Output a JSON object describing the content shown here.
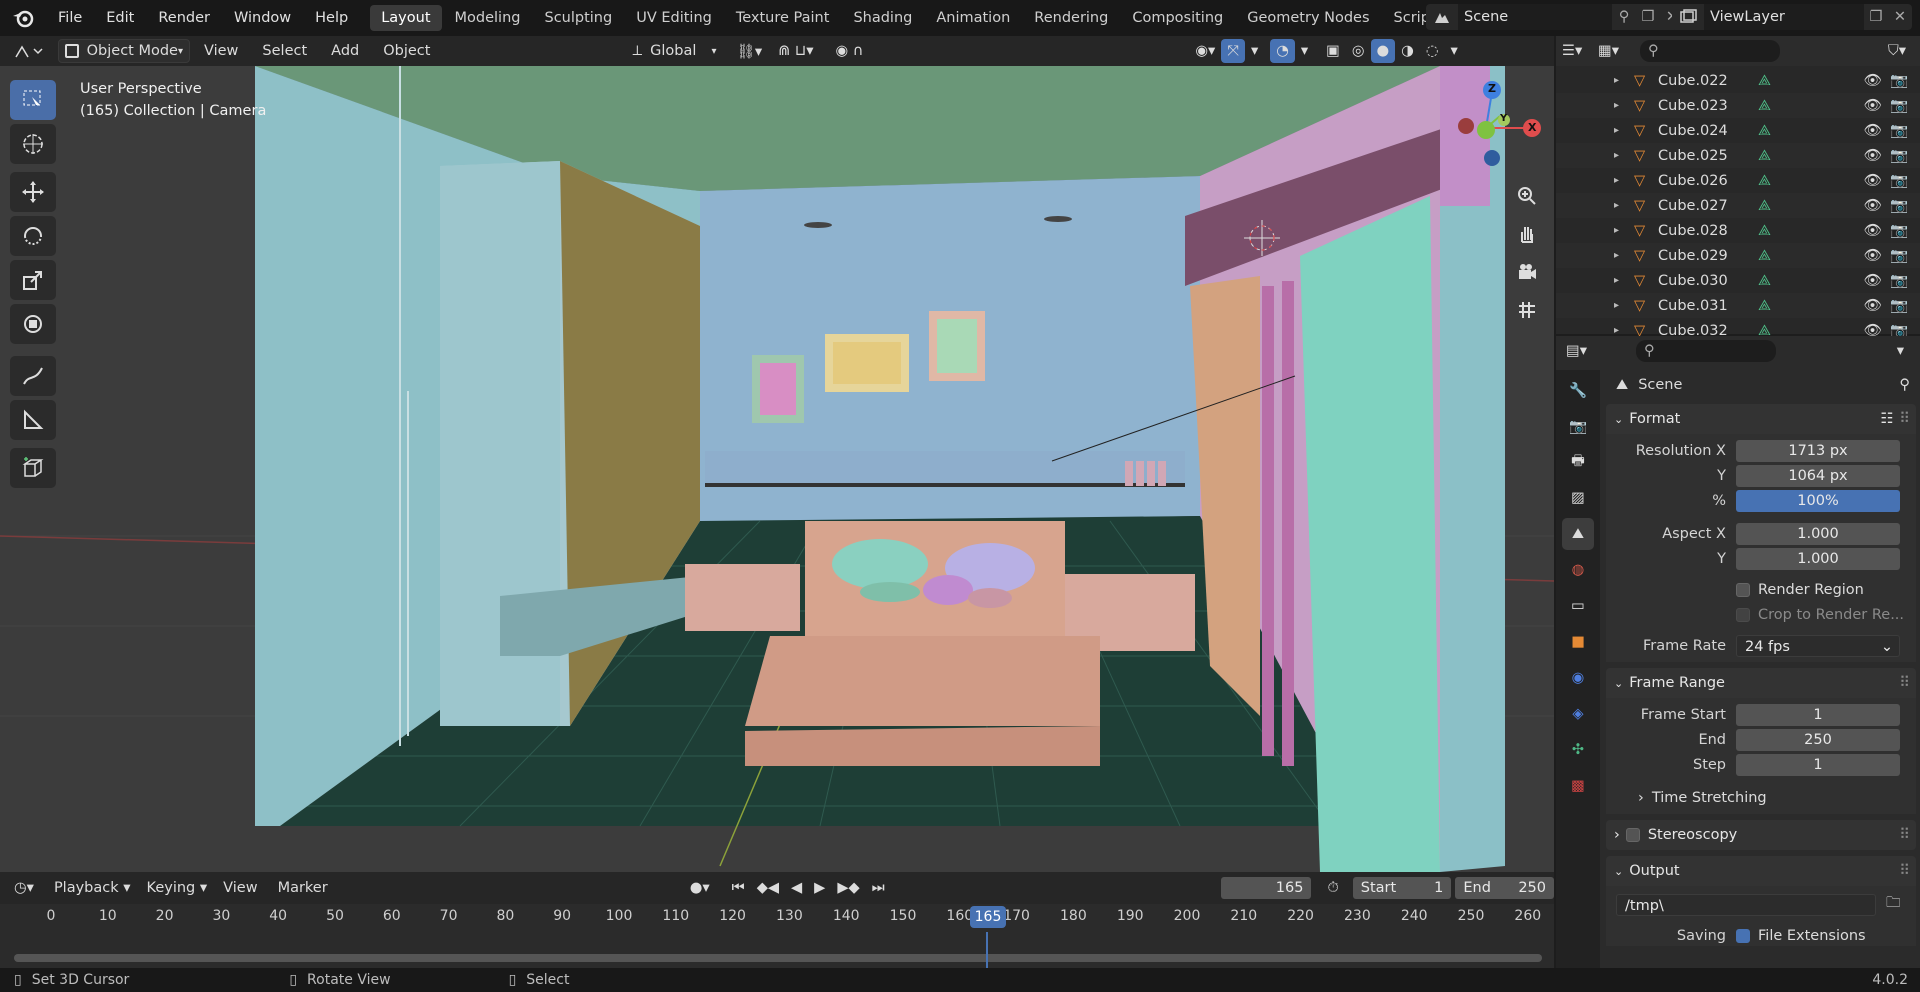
{
  "menus": [
    "File",
    "Edit",
    "Render",
    "Window",
    "Help"
  ],
  "workspaces": [
    {
      "label": "Layout",
      "active": true
    },
    {
      "label": "Modeling"
    },
    {
      "label": "Sculpting"
    },
    {
      "label": "UV Editing"
    },
    {
      "label": "Texture Paint"
    },
    {
      "label": "Shading"
    },
    {
      "label": "Animation"
    },
    {
      "label": "Rendering"
    },
    {
      "label": "Compositing"
    },
    {
      "label": "Geometry Nodes"
    },
    {
      "label": "Scripting"
    }
  ],
  "scene": {
    "name": "Scene"
  },
  "view_layer": {
    "name": "ViewLayer"
  },
  "viewport_header": {
    "mode": "Object Mode",
    "menus": [
      "View",
      "Select",
      "Add",
      "Object"
    ],
    "orientation": "Global"
  },
  "viewport": {
    "perspective": "User Perspective",
    "collection_line": "(165) Collection | Camera",
    "axes": {
      "z": "Z",
      "y": "Y",
      "x": "X"
    }
  },
  "outliner": {
    "items": [
      "Cube.022",
      "Cube.023",
      "Cube.024",
      "Cube.025",
      "Cube.026",
      "Cube.027",
      "Cube.028",
      "Cube.029",
      "Cube.030",
      "Cube.031",
      "Cube.032"
    ]
  },
  "properties": {
    "context": "Scene",
    "format": {
      "title": "Format",
      "res_x_label": "Resolution X",
      "res_x": "1713 px",
      "res_y_label": "Y",
      "res_y": "1064 px",
      "pct_label": "%",
      "pct": "100%",
      "aspect_x_label": "Aspect X",
      "aspect_x": "1.000",
      "aspect_y_label": "Y",
      "aspect_y": "1.000",
      "render_region": "Render Region",
      "crop": "Crop to Render Re...",
      "frame_rate_label": "Frame Rate",
      "frame_rate": "24 fps"
    },
    "frame_range": {
      "title": "Frame Range",
      "start_label": "Frame Start",
      "start": "1",
      "end_label": "End",
      "end": "250",
      "step_label": "Step",
      "step": "1",
      "time_stretching": "Time Stretching"
    },
    "stereoscopy": "Stereoscopy",
    "output": {
      "title": "Output",
      "path": "/tmp\\",
      "saving_label": "Saving",
      "file_ext": "File Extensions"
    }
  },
  "timeline": {
    "menus": [
      "Playback",
      "Keying",
      "View",
      "Marker"
    ],
    "current_frame": "165",
    "start_label": "Start",
    "start": "1",
    "end_label": "End",
    "end": "250",
    "ticks": [
      "0",
      "10",
      "20",
      "30",
      "40",
      "50",
      "60",
      "70",
      "80",
      "90",
      "100",
      "110",
      "120",
      "130",
      "140",
      "150",
      "160",
      "170",
      "180",
      "190",
      "200",
      "210",
      "220",
      "230",
      "240",
      "250",
      "260"
    ]
  },
  "status": {
    "left": "Set 3D Cursor",
    "middle": "Rotate View",
    "right": "Select",
    "version": "4.0.2"
  }
}
